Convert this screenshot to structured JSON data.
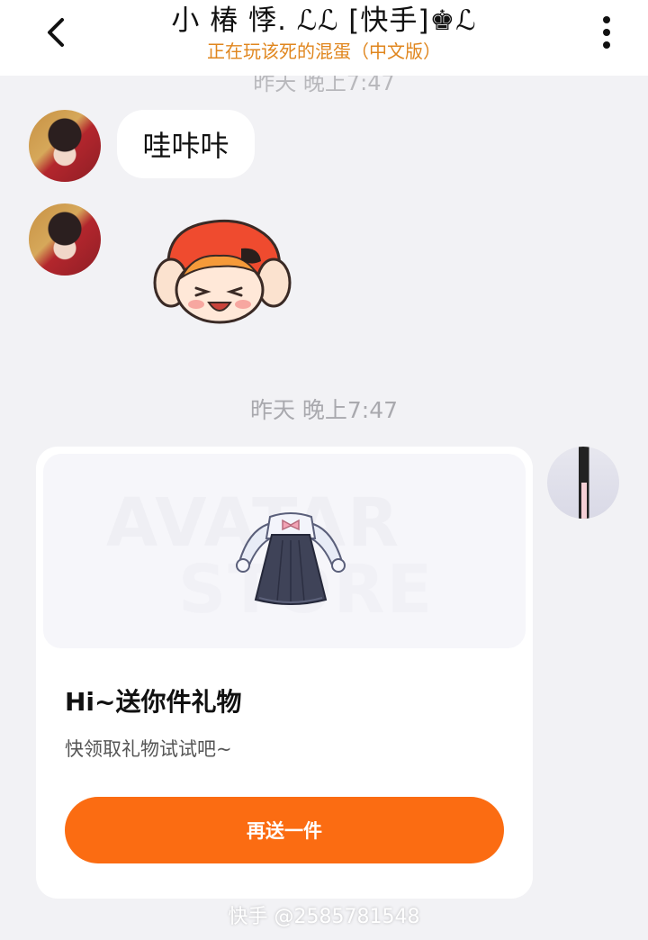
{
  "header": {
    "title": "小 椿 悸. ℒℒ [快手]♚ℒ",
    "subtitle": "正在玩该死的混蛋（中文版）"
  },
  "messages": {
    "hidden_time": "昨天 晚上7:47",
    "peer_text": "哇咔咔",
    "divider_time": "昨天 晚上7:47"
  },
  "gift_card": {
    "banner_watermark_1": "AVATAR",
    "banner_watermark_2": "STORE",
    "title": "Hi~送你件礼物",
    "description": "快领取礼物试试吧~",
    "button_label": "再送一件"
  },
  "footer": {
    "watermark": "快手 @2585781548"
  },
  "colors": {
    "accent": "#fb6c12",
    "subtitle": "#e0861e",
    "background": "#f2f2f5"
  },
  "icons": {
    "back": "chevron-left-icon",
    "more": "more-vertical-icon"
  }
}
